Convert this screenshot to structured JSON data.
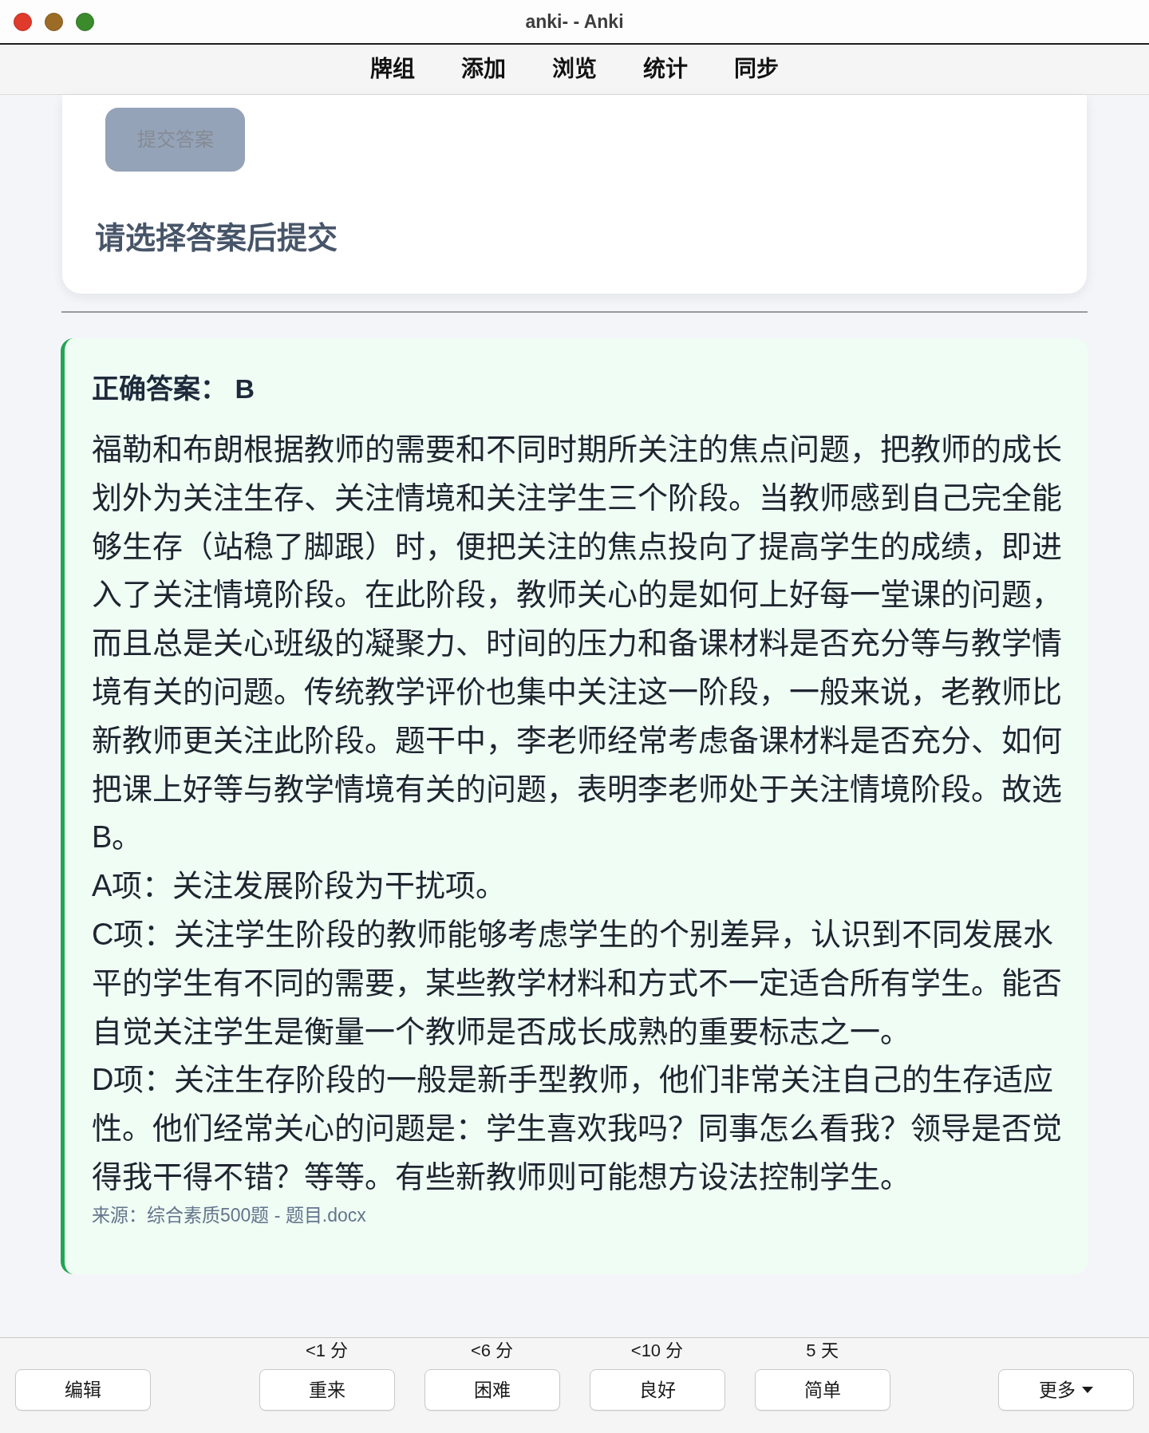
{
  "window": {
    "title": "anki- - Anki"
  },
  "toolbar": {
    "items": [
      "牌组",
      "添加",
      "浏览",
      "统计",
      "同步"
    ]
  },
  "question_card": {
    "submit_button": {
      "label": "提交答案",
      "disabled": true
    },
    "prompt": "请选择答案后提交"
  },
  "answer": {
    "heading": "正确答案： B",
    "paragraphs": [
      "福勒和布朗根据教师的需要和不同时期所关注的焦点问题，把教师的成长划外为关注生存、关注情境和关注学生三个阶段。当教师感到自己完全能够生存（站稳了脚跟）时，便把关注的焦点投向了提高学生的成绩，即进入了关注情境阶段。在此阶段，教师关心的是如何上好每一堂课的问题，而且总是关心班级的凝聚力、时间的压力和备课材料是否充分等与教学情境有关的问题。传统教学评价也集中关注这一阶段，一般来说，老教师比新教师更关注此阶段。题干中，李老师经常考虑备课材料是否充分、如何把课上好等与教学情境有关的问题，表明李老师处于关注情境阶段。故选B。",
      "A项：关注发展阶段为干扰项。",
      "C项：关注学生阶段的教师能够考虑学生的个别差异，认识到不同发展水平的学生有不同的需要，某些教学材料和方式不一定适合所有学生。能否自觉关注学生是衡量一个教师是否成长成熟的重要标志之一。",
      "D项：关注生存阶段的一般是新手型教师，他们非常关注自己的生存适应性。他们经常关心的问题是：学生喜欢我吗？同事怎么看我？领导是否觉得我干得不错？等等。有些新教师则可能想方设法控制学生。"
    ],
    "source": "来源：综合素质500题 - 题目.docx"
  },
  "review_bar": {
    "edit_button": "编辑",
    "answer_buttons": [
      {
        "interval": "<1 分",
        "label": "重来"
      },
      {
        "interval": "<6 分",
        "label": "困难"
      },
      {
        "interval": "<10 分",
        "label": "良好"
      },
      {
        "interval": "5 天",
        "label": "简单"
      }
    ],
    "more_button": "更多"
  }
}
